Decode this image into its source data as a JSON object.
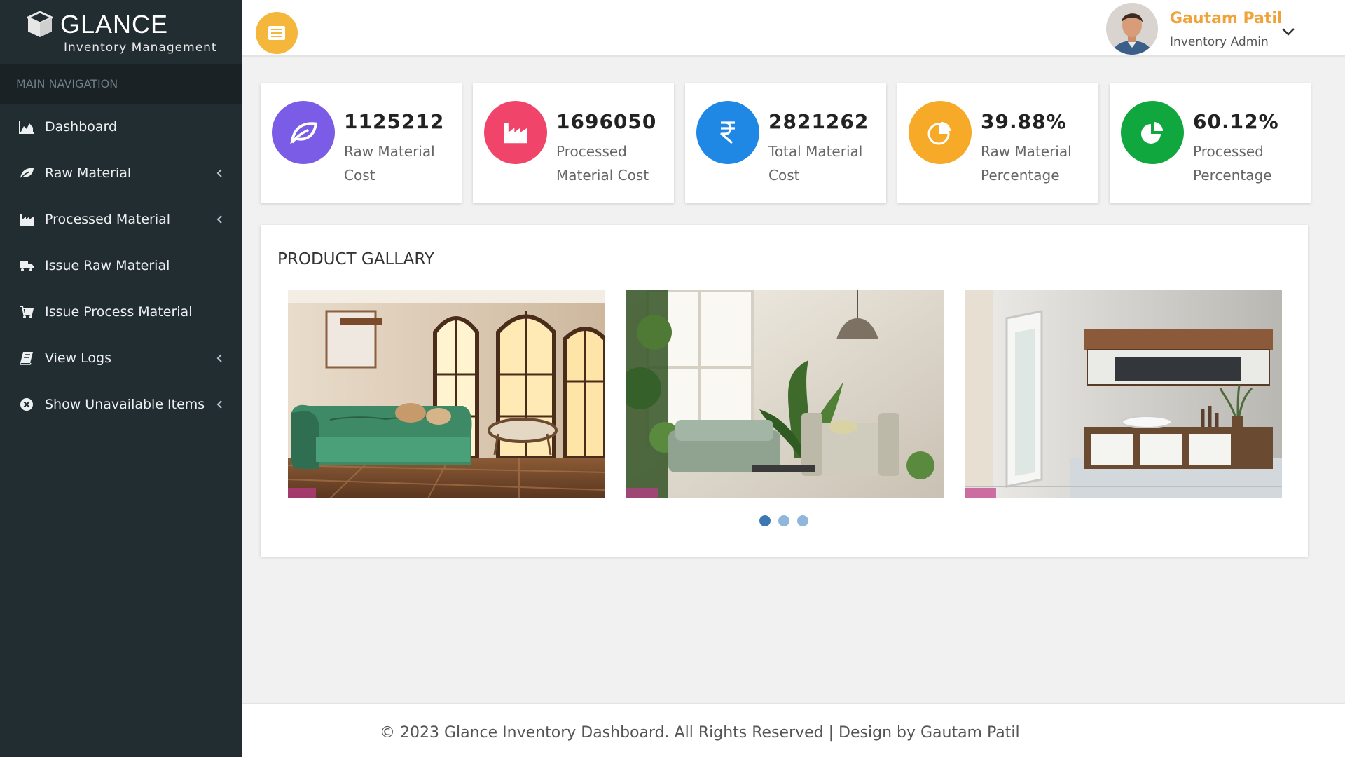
{
  "brand": {
    "name": "GLANCE",
    "subtitle": "Inventory Management"
  },
  "sidebar": {
    "header": "MAIN NAVIGATION",
    "items": [
      {
        "label": "Dashboard",
        "icon": "area-chart-icon",
        "has_submenu": false
      },
      {
        "label": "Raw Material",
        "icon": "leaf-icon",
        "has_submenu": true
      },
      {
        "label": "Processed Material",
        "icon": "industry-icon",
        "has_submenu": true
      },
      {
        "label": "Issue Raw Material",
        "icon": "truck-icon",
        "has_submenu": false
      },
      {
        "label": "Issue Process Material",
        "icon": "cart-icon",
        "has_submenu": false
      },
      {
        "label": "View Logs",
        "icon": "book-icon",
        "has_submenu": true
      },
      {
        "label": "Show Unavailable Items",
        "icon": "times-circle-icon",
        "has_submenu": true
      }
    ]
  },
  "topbar": {
    "user_name": "Gautam Patil",
    "user_role": "Inventory Admin"
  },
  "stats": [
    {
      "value": "1125212",
      "label": "Raw Material Cost",
      "color": "#7b5ce6",
      "icon": "leaf-icon"
    },
    {
      "value": "1696050",
      "label": "Processed Material Cost",
      "color": "#f0446b",
      "icon": "industry-icon"
    },
    {
      "value": "2821262",
      "label": "Total Material Cost",
      "color": "#1f88e5",
      "icon": "rupee-icon"
    },
    {
      "value": "39.88%",
      "label": "Raw Material Percentage",
      "color": "#f7a928",
      "icon": "pie-chart-icon"
    },
    {
      "value": "60.12%",
      "label": "Processed Percentage",
      "color": "#0fa73e",
      "icon": "pie-chart-icon"
    }
  ],
  "gallery": {
    "title": "PRODUCT GALLARY",
    "slides": 3,
    "active_slide": 1
  },
  "footer": {
    "text": "© 2023 Glance Inventory Dashboard. All Rights Reserved | Design by Gautam Patil"
  }
}
